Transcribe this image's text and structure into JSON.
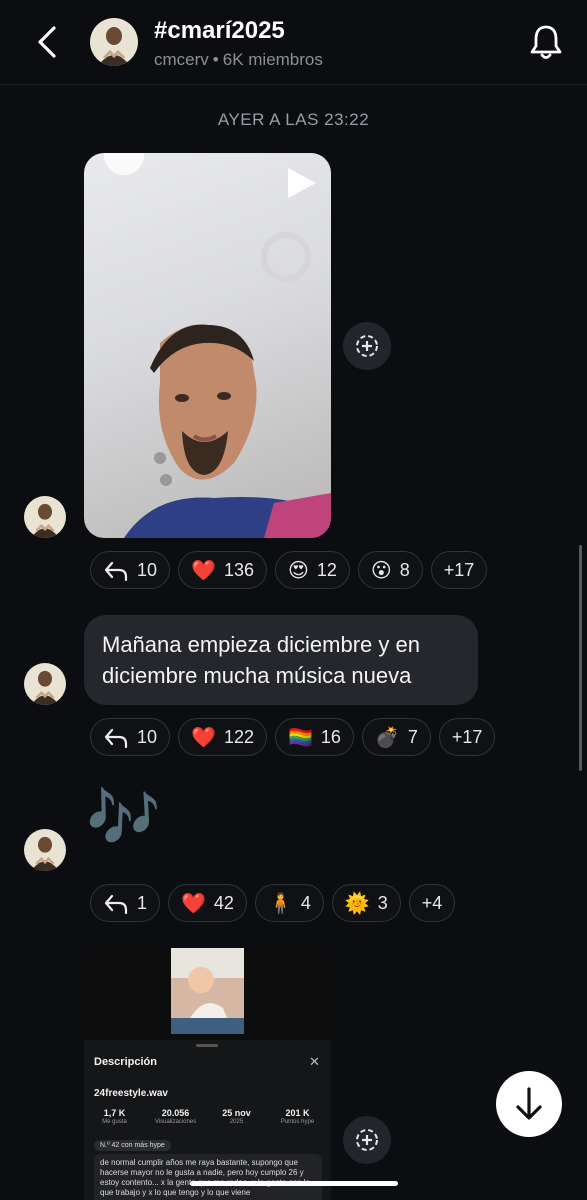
{
  "header": {
    "title": "#cmarí2025",
    "channel": "cmcerv",
    "separator": "•",
    "members": "6K miembros"
  },
  "timestamp": "AYER A LAS 23:22",
  "messages": [
    {
      "type": "video",
      "reactions": [
        {
          "icon": "reply-icon",
          "count": "10"
        },
        {
          "icon": "red-heart-emoji",
          "emoji": "❤️",
          "count": "136"
        },
        {
          "icon": "heart-eyes-emoji",
          "emoji": "😍",
          "count": "12"
        },
        {
          "icon": "surprised-face-emoji",
          "emoji": "😮",
          "count": "8"
        },
        {
          "icon": "more-reactions",
          "count": "+17"
        }
      ]
    },
    {
      "type": "text",
      "text": "Mañana empieza diciembre y en diciembre mucha música nueva",
      "reactions": [
        {
          "icon": "reply-icon",
          "count": "10"
        },
        {
          "icon": "red-heart-emoji",
          "emoji": "❤️",
          "count": "122"
        },
        {
          "icon": "rainbow-flag-emoji",
          "emoji": "🏳️‍🌈",
          "count": "16"
        },
        {
          "icon": "bomb-emoji",
          "emoji": "💣",
          "count": "7"
        },
        {
          "icon": "more-reactions",
          "count": "+17"
        }
      ]
    },
    {
      "type": "emoji",
      "text": "🎶",
      "reactions": [
        {
          "icon": "reply-icon",
          "count": "1"
        },
        {
          "icon": "red-heart-emoji",
          "emoji": "❤️",
          "count": "42"
        },
        {
          "icon": "person-standing-emoji",
          "emoji": "🧍",
          "count": "4"
        },
        {
          "icon": "sun-emoji",
          "emoji": "🌞",
          "count": "3"
        },
        {
          "icon": "more-reactions",
          "count": "+4"
        }
      ]
    }
  ],
  "card": {
    "sheet_title": "Descripción",
    "close": "✕",
    "filename": "24freestyle.wav",
    "stats": [
      {
        "value": "1,7 K",
        "label": "Me gusta"
      },
      {
        "value": "20.056",
        "label": "Visualizaciones"
      },
      {
        "value": "25 nov",
        "label": "2025"
      },
      {
        "value": "201 K",
        "label": "Puntos hype"
      }
    ],
    "hype_badge": "N.º 42 con más hype",
    "description": "de normal cumplir años me raya bastante, supongo que hacerse mayor no le gusta a nadie, pero hoy cumplo 26 y estoy contento... x la gente que me rodea, x la gente con la que trabajo y x lo que tengo y lo que viene"
  },
  "colors": {
    "background": "#0b0d10",
    "bubble": "#25272d",
    "pill_border": "#30343b",
    "muted_text": "#8b8f96"
  }
}
